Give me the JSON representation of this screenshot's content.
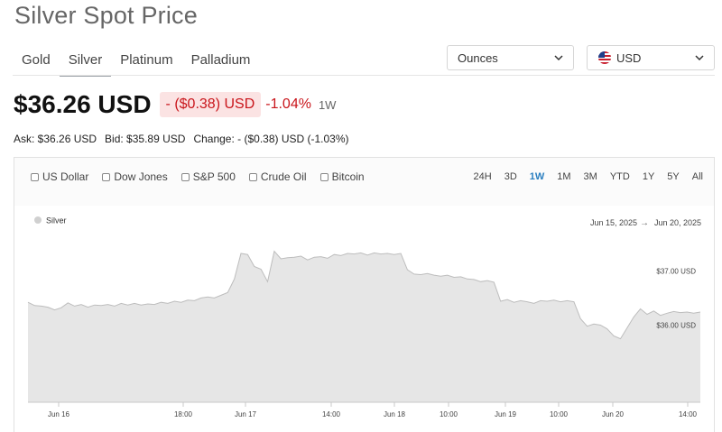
{
  "page": {
    "title": "Silver Spot Price"
  },
  "metal_tabs": [
    {
      "label": "Gold",
      "active": false
    },
    {
      "label": "Silver",
      "active": true
    },
    {
      "label": "Platinum",
      "active": false
    },
    {
      "label": "Palladium",
      "active": false
    }
  ],
  "units_select": {
    "value": "Ounces"
  },
  "currency_select": {
    "value": "USD"
  },
  "quote": {
    "price": "$36.26 USD",
    "change": "- ($0.38) USD",
    "change_pct": "-1.04%",
    "period": "1W",
    "ask": "Ask: $36.26 USD",
    "bid": "Bid: $35.89 USD",
    "change_line": "Change: - ($0.38) USD (-1.03%)"
  },
  "compare_options": [
    "US Dollar",
    "Dow Jones",
    "S&P 500",
    "Crude Oil",
    "Bitcoin"
  ],
  "ranges": [
    {
      "label": "24H",
      "active": false
    },
    {
      "label": "3D",
      "active": false
    },
    {
      "label": "1W",
      "active": true
    },
    {
      "label": "1M",
      "active": false
    },
    {
      "label": "3M",
      "active": false
    },
    {
      "label": "YTD",
      "active": false
    },
    {
      "label": "1Y",
      "active": false
    },
    {
      "label": "5Y",
      "active": false
    },
    {
      "label": "All",
      "active": false
    }
  ],
  "colors": {
    "negative": "#c9151b",
    "active_range": "#2a7fc0",
    "area_fill": "#e6e6e6",
    "line": "#bdbdbd"
  },
  "chart_data": {
    "type": "area",
    "legend": "Silver",
    "date_range": {
      "start": "Jun 15, 2025",
      "end": "Jun 20, 2025"
    },
    "x_ticks": [
      "Jun 16",
      "18:00",
      "Jun 17",
      "14:00",
      "Jun 18",
      "10:00",
      "Jun 19",
      "10:00",
      "Jun 20",
      "14:00"
    ],
    "y_ticks": [
      {
        "value": 37.0,
        "label": "$37.00 USD"
      },
      {
        "value": 36.0,
        "label": "$36.00 USD"
      }
    ],
    "ylim": [
      33.8,
      38.2
    ],
    "series": [
      {
        "name": "Silver",
        "values": [
          36.42,
          36.36,
          36.35,
          36.33,
          36.28,
          36.32,
          36.41,
          36.35,
          36.38,
          36.33,
          36.37,
          36.36,
          36.38,
          36.35,
          36.4,
          36.37,
          36.4,
          36.37,
          36.39,
          36.38,
          36.42,
          36.4,
          36.44,
          36.42,
          36.46,
          36.45,
          36.5,
          36.52,
          36.5,
          36.55,
          36.6,
          36.85,
          37.32,
          37.3,
          37.08,
          37.03,
          36.8,
          37.36,
          37.22,
          37.24,
          37.25,
          37.27,
          37.2,
          37.25,
          37.26,
          37.23,
          37.3,
          37.28,
          37.32,
          37.31,
          37.33,
          37.29,
          37.33,
          37.31,
          37.32,
          37.3,
          37.32,
          37.02,
          36.94,
          36.93,
          36.95,
          36.92,
          36.9,
          36.92,
          36.88,
          36.89,
          36.85,
          36.84,
          36.8,
          36.82,
          36.79,
          36.44,
          36.47,
          36.42,
          36.45,
          36.43,
          36.4,
          36.45,
          36.44,
          36.46,
          36.43,
          36.45,
          36.43,
          36.12,
          35.98,
          36.02,
          36.0,
          35.93,
          35.8,
          35.75,
          35.95,
          36.15,
          36.3,
          36.2,
          36.26,
          36.18,
          36.22,
          36.25,
          36.23,
          36.24,
          36.22,
          36.24
        ]
      }
    ]
  }
}
